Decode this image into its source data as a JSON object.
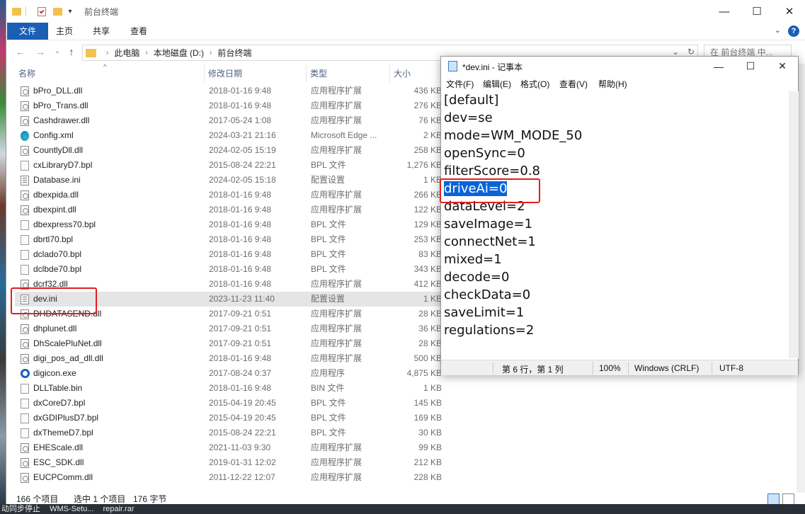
{
  "explorer": {
    "title": "前台终端",
    "window_controls": {
      "minimize": "—",
      "maximize": "☐",
      "close": "✕"
    },
    "ribbon": {
      "tabs": [
        "文件",
        "主页",
        "共享",
        "查看"
      ],
      "help": "?",
      "expand": "⌄"
    },
    "nav": {
      "back": "←",
      "forward": "→",
      "recent": "⌄",
      "up": "↑"
    },
    "address": {
      "parts": [
        "此电脑",
        "本地磁盘 (D:)",
        "前台终端"
      ],
      "separator": "›",
      "dropdown": "⌄",
      "refresh": "↻"
    },
    "search_placeholder": "在 前台终端 中...",
    "columns": {
      "name": "名称",
      "date": "修改日期",
      "type": "类型",
      "size": "大小",
      "sort": "^"
    },
    "files": [
      {
        "name": "bPro_DLL.dll",
        "date": "2018-01-16 9:48",
        "type": "应用程序扩展",
        "size": "436 KB",
        "icon": "dll"
      },
      {
        "name": "bPro_Trans.dll",
        "date": "2018-01-16 9:48",
        "type": "应用程序扩展",
        "size": "276 KB",
        "icon": "dll"
      },
      {
        "name": "Cashdrawer.dll",
        "date": "2017-05-24 1:08",
        "type": "应用程序扩展",
        "size": "76 KB",
        "icon": "dll"
      },
      {
        "name": "Config.xml",
        "date": "2024-03-21 21:16",
        "type": "Microsoft Edge ...",
        "size": "2 KB",
        "icon": "edge"
      },
      {
        "name": "CountlyDll.dll",
        "date": "2024-02-05 15:19",
        "type": "应用程序扩展",
        "size": "258 KB",
        "icon": "dll"
      },
      {
        "name": "cxLibraryD7.bpl",
        "date": "2015-08-24 22:21",
        "type": "BPL 文件",
        "size": "1,276 KB",
        "icon": "file"
      },
      {
        "name": "Database.ini",
        "date": "2024-02-05 15:18",
        "type": "配置设置",
        "size": "1 KB",
        "icon": "ini"
      },
      {
        "name": "dbexpida.dll",
        "date": "2018-01-16 9:48",
        "type": "应用程序扩展",
        "size": "266 KB",
        "icon": "dll"
      },
      {
        "name": "dbexpint.dll",
        "date": "2018-01-16 9:48",
        "type": "应用程序扩展",
        "size": "122 KB",
        "icon": "dll"
      },
      {
        "name": "dbexpress70.bpl",
        "date": "2018-01-16 9:48",
        "type": "BPL 文件",
        "size": "129 KB",
        "icon": "file"
      },
      {
        "name": "dbrtl70.bpl",
        "date": "2018-01-16 9:48",
        "type": "BPL 文件",
        "size": "253 KB",
        "icon": "file"
      },
      {
        "name": "dclado70.bpl",
        "date": "2018-01-16 9:48",
        "type": "BPL 文件",
        "size": "83 KB",
        "icon": "file"
      },
      {
        "name": "dclbde70.bpl",
        "date": "2018-01-16 9:48",
        "type": "BPL 文件",
        "size": "343 KB",
        "icon": "file"
      },
      {
        "name": "dcrf32.dll",
        "date": "2018-01-16 9:48",
        "type": "应用程序扩展",
        "size": "412 KB",
        "icon": "dll"
      },
      {
        "name": "dev.ini",
        "date": "2023-11-23 11:40",
        "type": "配置设置",
        "size": "1 KB",
        "icon": "ini"
      },
      {
        "name": "DHDATASEND.dll",
        "date": "2017-09-21 0:51",
        "type": "应用程序扩展",
        "size": "28 KB",
        "icon": "dll"
      },
      {
        "name": "dhplunet.dll",
        "date": "2017-09-21 0:51",
        "type": "应用程序扩展",
        "size": "36 KB",
        "icon": "dll"
      },
      {
        "name": "DhScalePluNet.dll",
        "date": "2017-09-21 0:51",
        "type": "应用程序扩展",
        "size": "28 KB",
        "icon": "dll"
      },
      {
        "name": "digi_pos_ad_dll.dll",
        "date": "2018-01-16 9:48",
        "type": "应用程序扩展",
        "size": "500 KB",
        "icon": "dll"
      },
      {
        "name": "digicon.exe",
        "date": "2017-08-24 0:37",
        "type": "应用程序",
        "size": "4,875 KB",
        "icon": "exe"
      },
      {
        "name": "DLLTable.bin",
        "date": "2018-01-16 9:48",
        "type": "BIN 文件",
        "size": "1 KB",
        "icon": "file"
      },
      {
        "name": "dxCoreD7.bpl",
        "date": "2015-04-19 20:45",
        "type": "BPL 文件",
        "size": "145 KB",
        "icon": "file"
      },
      {
        "name": "dxGDIPlusD7.bpl",
        "date": "2015-04-19 20:45",
        "type": "BPL 文件",
        "size": "169 KB",
        "icon": "file"
      },
      {
        "name": "dxThemeD7.bpl",
        "date": "2015-08-24 22:21",
        "type": "BPL 文件",
        "size": "30 KB",
        "icon": "file"
      },
      {
        "name": "EHEScale.dll",
        "date": "2021-11-03 9:30",
        "type": "应用程序扩展",
        "size": "99 KB",
        "icon": "dll"
      },
      {
        "name": "ESC_SDK.dll",
        "date": "2019-01-31 12:02",
        "type": "应用程序扩展",
        "size": "212 KB",
        "icon": "dll"
      },
      {
        "name": "EUCPComm.dll",
        "date": "2011-12-22 12:07",
        "type": "应用程序扩展",
        "size": "228 KB",
        "icon": "dll"
      }
    ],
    "status": {
      "count": "166 个项目",
      "selected": "选中 1 个项目",
      "bytes": "176 字节"
    }
  },
  "notepad": {
    "title": "*dev.ini - 记事本",
    "window_controls": {
      "minimize": "—",
      "maximize": "☐",
      "close": "✕"
    },
    "menu": [
      "文件(F)",
      "编辑(E)",
      "格式(O)",
      "查看(V)",
      "帮助(H)"
    ],
    "lines": [
      "[default]",
      "dev=se",
      "mode=WM_MODE_50",
      "openSync=0",
      "filterScore=0.8",
      "driveAi=0",
      "dataLevel=2",
      "saveImage=1",
      "connectNet=1",
      "mixed=1",
      "decode=0",
      "checkData=0",
      "saveLimit=1",
      "regulations=2"
    ],
    "selected_line_index": 5,
    "status": {
      "position": "第 6 行，第 1 列",
      "zoom": "100%",
      "line_ending": "Windows (CRLF)",
      "encoding": "UTF-8"
    }
  },
  "taskbar_text": [
    "动同步停止",
    "WMS-Setu...",
    "repair.rar"
  ],
  "colors": {
    "accent": "#1a5fb4",
    "annotation": "#e02020",
    "selection_highlight": "#0a64d8"
  }
}
